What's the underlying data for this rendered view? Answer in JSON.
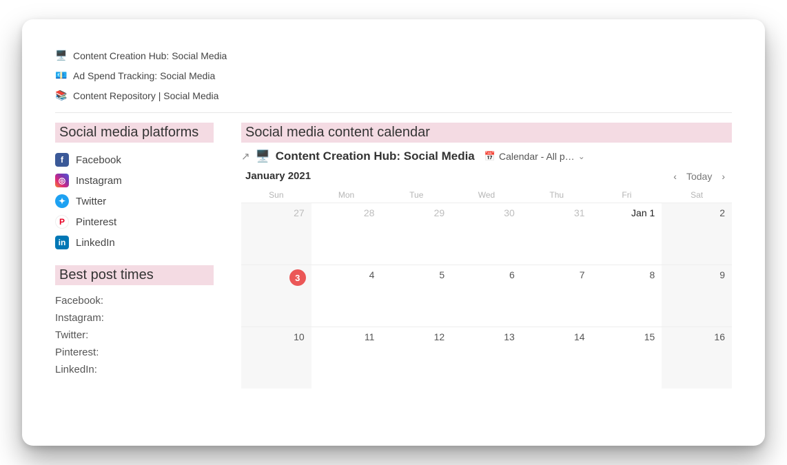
{
  "topLinks": [
    {
      "icon": "🖥️",
      "label": "Content Creation Hub: Social Media"
    },
    {
      "icon": "💶",
      "label": "Ad Spend Tracking: Social Media"
    },
    {
      "icon": "📚",
      "label": "Content Repository | Social Media"
    }
  ],
  "sidebar": {
    "platformsHeading": "Social media platforms",
    "platforms": [
      {
        "key": "fb",
        "glyph": "f",
        "label": "Facebook"
      },
      {
        "key": "ig",
        "glyph": "◎",
        "label": "Instagram"
      },
      {
        "key": "tw",
        "glyph": "✦",
        "label": "Twitter"
      },
      {
        "key": "pt",
        "glyph": "P",
        "label": "Pinterest"
      },
      {
        "key": "li",
        "glyph": "in",
        "label": "LinkedIn"
      }
    ],
    "bestTimesHeading": "Best post times",
    "bestTimes": [
      "Facebook:",
      "Instagram:",
      "Twitter:",
      "Pinterest:",
      "LinkedIn:"
    ]
  },
  "main": {
    "heading": "Social media content calendar",
    "breadcrumbIcon": "🖥️",
    "breadcrumbTitle": "Content Creation Hub: Social Media",
    "viewLabel": "Calendar - All p…",
    "monthLabel": "January 2021",
    "todayLabel": "Today",
    "dow": [
      "Sun",
      "Mon",
      "Tue",
      "Wed",
      "Thu",
      "Fri",
      "Sat"
    ],
    "cells": [
      {
        "t": "27",
        "in": false
      },
      {
        "t": "28",
        "in": false
      },
      {
        "t": "29",
        "in": false
      },
      {
        "t": "30",
        "in": false
      },
      {
        "t": "31",
        "in": false
      },
      {
        "t": "Jan 1",
        "in": true,
        "strong": true
      },
      {
        "t": "2",
        "in": true
      },
      {
        "t": "3",
        "in": true,
        "today": true
      },
      {
        "t": "4",
        "in": true
      },
      {
        "t": "5",
        "in": true
      },
      {
        "t": "6",
        "in": true
      },
      {
        "t": "7",
        "in": true
      },
      {
        "t": "8",
        "in": true
      },
      {
        "t": "9",
        "in": true
      },
      {
        "t": "10",
        "in": true
      },
      {
        "t": "11",
        "in": true
      },
      {
        "t": "12",
        "in": true
      },
      {
        "t": "13",
        "in": true
      },
      {
        "t": "14",
        "in": true
      },
      {
        "t": "15",
        "in": true
      },
      {
        "t": "16",
        "in": true
      }
    ]
  }
}
